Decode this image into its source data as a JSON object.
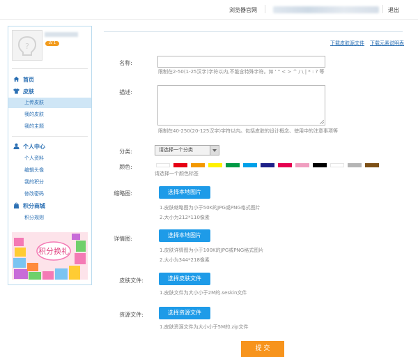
{
  "topbar": {
    "browser_home": "浏览器官网",
    "logout": "退出"
  },
  "user": {
    "level": "LV 1"
  },
  "sidebar": {
    "home": "首页",
    "skin": "皮肤",
    "skin_items": [
      "上传皮肤",
      "我的皮肤",
      "我的主题"
    ],
    "personal": "个人中心",
    "personal_items": [
      "个人资料",
      "编辑头像",
      "我的积分",
      "修改密码"
    ],
    "mall": "积分商城",
    "mall_items": [
      "积分规则"
    ],
    "gift_text": "积分换礼"
  },
  "downloads": {
    "source": "下载皮肤源文件",
    "manual": "下载元素说明表"
  },
  "form": {
    "name_label": "名称:",
    "name_hint": "限制在2-50(1-25汉字)字符以内,不能含特殊字符。如 ' \" < > ^ / \\ | * : ? 等",
    "desc_label": "描述:",
    "desc_hint": "限制在40-250(20-125汉字)字符以内。包括皮肤的设计概念、使用中的注意事项等",
    "category_label": "分类:",
    "category_selected": "请选择一个分类",
    "color_label": "颜色:",
    "color_hint": "请选择一个颜色标签",
    "colors": [
      "#ffffff",
      "#e60012",
      "#f39800",
      "#fff100",
      "#009944",
      "#00a0e9",
      "#1d2088",
      "#e5004f",
      "#f09ec0",
      "#000000",
      "#ffffff",
      "#b5b5b5",
      "#7d5016"
    ],
    "thumb_label": "缩略图:",
    "thumb_button": "选择本地图片",
    "thumb_hint1": "1.皮肤缩略图为小于50K的JPG或PNG格式图片",
    "thumb_hint2": "2.大小为212*110像素",
    "detail_label": "详情图:",
    "detail_button": "选择本地图片",
    "detail_hint1": "1.皮肤详情图为小于100K的JPG或PNG格式图片",
    "detail_hint2": "2.大小为344*218像素",
    "skinfile_label": "皮肤文件:",
    "skinfile_button": "选择皮肤文件",
    "skinfile_hint": "1.皮肤文件为大小小于2M的.seskin文件",
    "resfile_label": "资源文件:",
    "resfile_button": "选择资源文件",
    "resfile_hint": "1.皮肤资源文件为大小小于5M的.zip文件",
    "submit": "提 交"
  }
}
